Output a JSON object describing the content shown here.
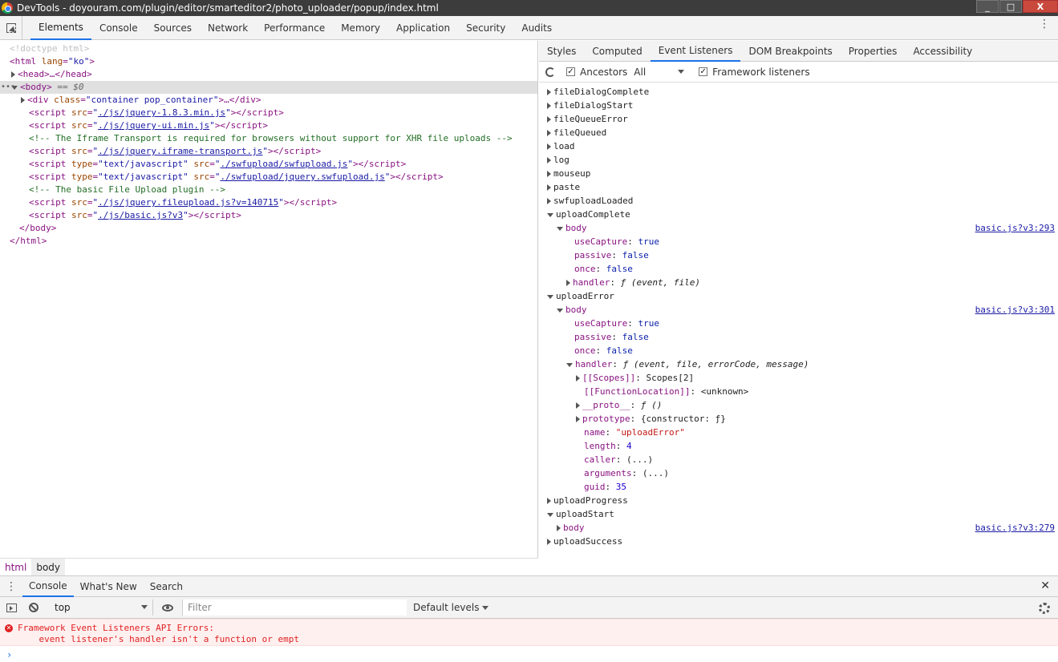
{
  "window": {
    "title": "DevTools - doyouram.com/plugin/editor/smarteditor2/photo_uploader/popup/index.html",
    "buttons": [
      "_",
      "□",
      "X"
    ]
  },
  "main_tabs": [
    {
      "label": "Elements",
      "active": true
    },
    {
      "label": "Console"
    },
    {
      "label": "Sources"
    },
    {
      "label": "Network"
    },
    {
      "label": "Performance"
    },
    {
      "label": "Memory"
    },
    {
      "label": "Application"
    },
    {
      "label": "Security"
    },
    {
      "label": "Audits"
    }
  ],
  "menu_glyph": "⋮",
  "dom": {
    "doctype": "<!doctype html>",
    "html_open": {
      "tag": "html",
      "attr": "lang",
      "value": "ko"
    },
    "head": "<head>…</head>",
    "body_open": "<body>",
    "body_eq": "== $0",
    "div": {
      "attr": "class",
      "value": "container pop_container",
      "ellipsis": "…</div>"
    },
    "scripts": [
      {
        "kind": "script",
        "type": null,
        "src": "./js/jquery-1.8.3.min.js"
      },
      {
        "kind": "script",
        "type": null,
        "src": "./js/jquery-ui.min.js"
      },
      {
        "kind": "comment",
        "text": "<!-- The Iframe Transport is required for browsers without support for XHR file uploads -->"
      },
      {
        "kind": "script",
        "type": null,
        "src": "./js/jquery.iframe-transport.js"
      },
      {
        "kind": "script",
        "type": "text/javascript",
        "src": "./swfupload/swfupload.js"
      },
      {
        "kind": "script",
        "type": "text/javascript",
        "src": "./swfupload/jquery.swfupload.js"
      },
      {
        "kind": "comment",
        "text": "<!-- The basic File Upload plugin -->"
      },
      {
        "kind": "script",
        "type": null,
        "src": "./js/jquery.fileupload.js?v=140715"
      },
      {
        "kind": "script",
        "type": null,
        "src": "./js/basic.js?v3"
      }
    ],
    "body_close": "</body>",
    "html_close": "</html>"
  },
  "breadcrumb": [
    "html",
    "body"
  ],
  "side_tabs": [
    {
      "label": "Styles"
    },
    {
      "label": "Computed"
    },
    {
      "label": "Event Listeners",
      "active": true
    },
    {
      "label": "DOM Breakpoints"
    },
    {
      "label": "Properties"
    },
    {
      "label": "Accessibility"
    }
  ],
  "listener_toolbar": {
    "ancestors_label": "Ancestors",
    "ancestors_checked": true,
    "select_value": "All",
    "framework_label": "Framework listeners",
    "framework_checked": true,
    "check_glyph": "✓"
  },
  "events_top": [
    "fileDialogComplete",
    "fileDialogStart",
    "fileQueueError",
    "fileQueued",
    "load",
    "log",
    "mouseup",
    "paste",
    "swfuploadLoaded"
  ],
  "upload_complete": {
    "name": "uploadComplete",
    "target": "body",
    "source": "basic.js?v3:293",
    "useCapture": "true",
    "passive": "false",
    "once": "false",
    "handler": "ƒ (event, file)"
  },
  "upload_error": {
    "name": "uploadError",
    "target": "body",
    "source": "basic.js?v3:301",
    "useCapture": "true",
    "passive": "false",
    "once": "false",
    "handler": "ƒ (event, file, errorCode, message)",
    "scopes": "Scopes[2]",
    "function_location": "<unknown>",
    "proto": "ƒ ()",
    "prototype": "{constructor: ƒ}",
    "fn_name": "\"uploadError\"",
    "length": "4",
    "caller": "(...)",
    "arguments": "(...)",
    "guid": "35"
  },
  "labels": {
    "useCapture": "useCapture",
    "passive": "passive",
    "once": "once",
    "handler": "handler",
    "scopes": "[[Scopes]]",
    "function_location": "[[FunctionLocation]]",
    "proto": "__proto__",
    "prototype": "prototype",
    "name": "name",
    "length": "length",
    "caller": "caller",
    "arguments": "arguments",
    "guid": "guid",
    "colon": ": "
  },
  "upload_progress": "uploadProgress",
  "upload_start": {
    "name": "uploadStart",
    "target": "body",
    "source": "basic.js?v3:279"
  },
  "upload_success": "uploadSuccess",
  "drawer_tabs": [
    {
      "label": "Console",
      "active": true
    },
    {
      "label": "What's New"
    },
    {
      "label": "Search"
    }
  ],
  "drawer_close": "✕",
  "console_toolbar": {
    "context": "top",
    "filter_placeholder": "Filter",
    "levels": "Default levels"
  },
  "console_messages": {
    "error_glyph": "✕",
    "error_line1": "Framework Event Listeners API Errors:",
    "error_line2": "    event listener's handler isn't a function or empt",
    "prompt": "›"
  },
  "colors": {
    "accent": "#1a73e8",
    "tag": "#881280",
    "error": "#e02020"
  }
}
